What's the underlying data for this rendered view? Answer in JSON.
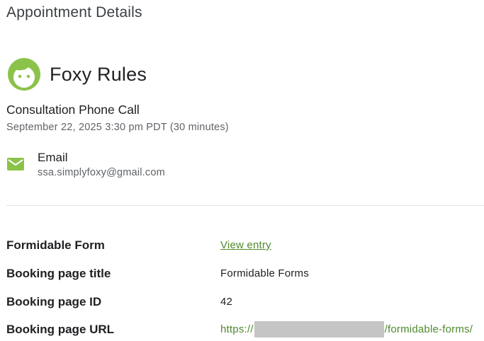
{
  "header": {
    "title": "Appointment Details"
  },
  "profile": {
    "name": "Foxy Rules",
    "avatar_icon": "face-avatar-icon",
    "avatar_color": "#8bc34a"
  },
  "appointment": {
    "title": "Consultation Phone Call",
    "datetime": "September 22, 2025 3:30 pm PDT (30 minutes)"
  },
  "contact": {
    "icon": "mail-icon",
    "icon_color": "#8bc34a",
    "label": "Email",
    "value": "ssa.simplyfoxy@gmail.com"
  },
  "details": [
    {
      "label": "Formidable Form",
      "value": "View entry"
    },
    {
      "label": "Booking page title",
      "value": "Formidable Forms"
    },
    {
      "label": "Booking page ID",
      "value": "42"
    },
    {
      "label": "Booking page URL",
      "url_prefix": "https://",
      "url_suffix": "/formidable-forms/"
    }
  ],
  "colors": {
    "link": "#4f8a2e",
    "accent": "#8bc34a",
    "redaction": "#c5c5c5"
  }
}
